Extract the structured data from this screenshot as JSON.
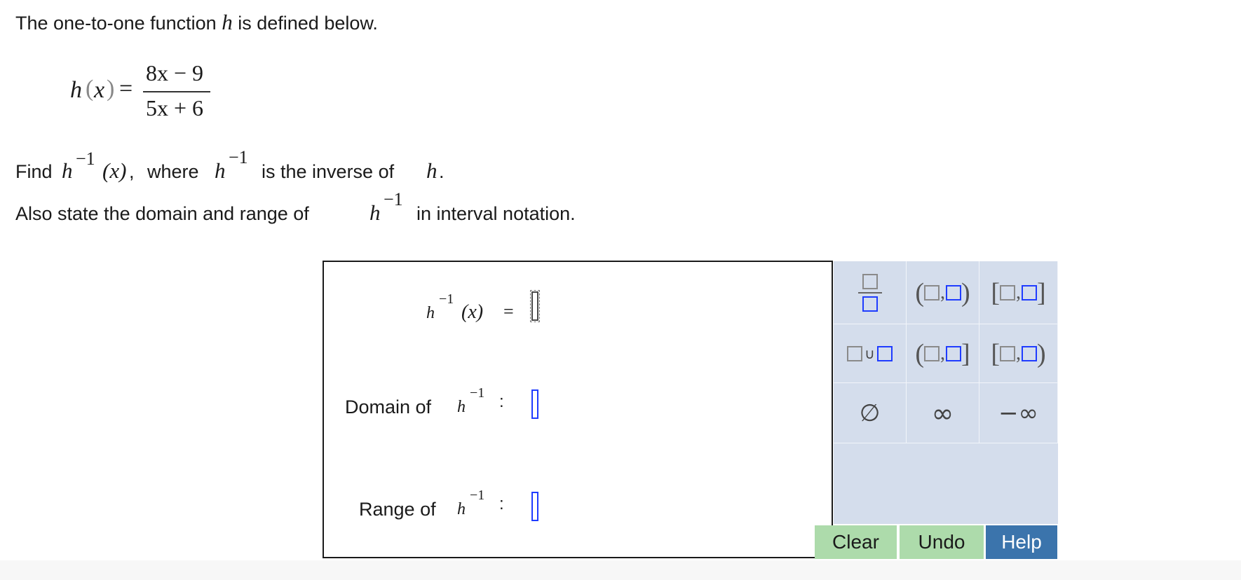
{
  "intro": {
    "pre": "The one-to-one function",
    "var": "h",
    "post": "is defined below."
  },
  "definition": {
    "func": "h",
    "arg": "x",
    "numerator": "8x − 9",
    "denominator": "5x + 6"
  },
  "instruction1": {
    "find": "Find",
    "h1": "h",
    "x": "(x)",
    "comma": ",",
    "where": "where",
    "h2": "h",
    "is_inverse": "is the inverse of",
    "h3": "h",
    "period": "."
  },
  "instruction2": {
    "pre": "Also state the domain and range of",
    "h": "h",
    "post": "in interval notation."
  },
  "inverse_exp": "−1",
  "answer": {
    "inverse_lhs": {
      "h": "h",
      "x": "(x)",
      "eq": "="
    },
    "domain_label": "Domain of",
    "range_label": "Range of",
    "h": "h",
    "colon": ":"
  },
  "keypad": {
    "keys": [
      "fraction",
      "open-interval",
      "closed-interval",
      "union",
      "left-open-interval",
      "right-open-interval",
      "empty-set",
      "infinity",
      "negative-infinity"
    ],
    "empty_set": "∅",
    "infinity": "∞",
    "neg_infinity": "−∞",
    "union": "∪",
    "clear": "Clear",
    "undo": "Undo",
    "help": "Help"
  },
  "colors": {
    "keypad_bg": "#d4ddec",
    "clear_undo_bg": "#addbab",
    "help_bg": "#3b74ac",
    "slot_border": "#1f3cff"
  }
}
